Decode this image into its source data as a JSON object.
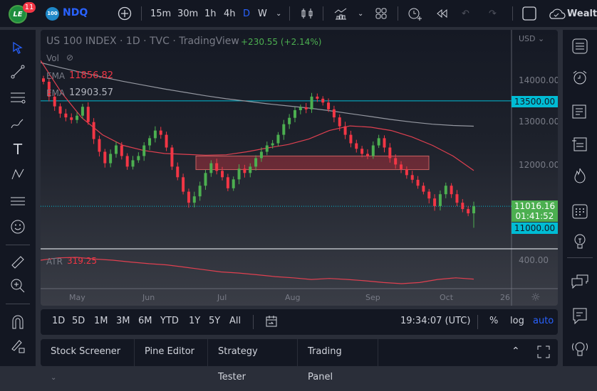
{
  "topbar": {
    "notifications": "11",
    "symbol_badge": "100",
    "symbol": "NDQ",
    "intervals": [
      "15m",
      "30m",
      "1h",
      "4h",
      "D",
      "W"
    ],
    "active_interval": "D",
    "publish_label": "Wealth"
  },
  "legend": {
    "title": "US 100 INDEX · 1D · TVC · TradingView",
    "change": "+230.55 (+2.14%)",
    "vol": "Vol",
    "ema1_label": "EMA",
    "ema1_value": "11856.82",
    "ema2_label": "EMA",
    "ema2_value": "12903.57",
    "atr_label": "ATR",
    "atr_value": "319.25"
  },
  "price_axis": {
    "currency": "USD",
    "ticks": [
      "14000.00",
      "13000.00",
      "12000.00"
    ],
    "hline_label": "13500.00",
    "last_price": "11016.16",
    "countdown": "01:41:52",
    "alert_label": "11000.00",
    "atr_tick": "400.00"
  },
  "time_axis": [
    "May",
    "Jun",
    "Jul",
    "Aug",
    "Sep",
    "Oct",
    "26"
  ],
  "timebar": {
    "ranges": [
      "1D",
      "5D",
      "1M",
      "3M",
      "6M",
      "YTD",
      "1Y",
      "5Y",
      "All"
    ],
    "clock": "19:34:07 (UTC)",
    "percent": "%",
    "log": "log",
    "auto": "auto"
  },
  "bottom_tabs": [
    "Stock Screener",
    "Pine Editor",
    "Strategy Tester",
    "Trading Panel"
  ],
  "colors": {
    "up": "#26a69a",
    "down": "#f23645",
    "green": "#4caf50",
    "cyan": "#00bcd4",
    "accent": "#2962ff",
    "ema_fast": "#e04050",
    "ema_slow": "#9598a1"
  },
  "chart_data": {
    "type": "candlestick",
    "closes": [
      13950,
      13600,
      13370,
      13200,
      13110,
      13050,
      13150,
      13360,
      13000,
      12600,
      12300,
      12030,
      12250,
      12450,
      12200,
      11950,
      12100,
      12200,
      12450,
      12620,
      12800,
      12700,
      12400,
      11950,
      11700,
      11360,
      11100,
      11250,
      11500,
      11800,
      12030,
      11850,
      11700,
      11440,
      11650,
      11900,
      11800,
      11950,
      12150,
      12300,
      12450,
      12500,
      12700,
      12950,
      13100,
      13280,
      13350,
      13300,
      13600,
      13550,
      13460,
      13300,
      13110,
      12900,
      12700,
      12500,
      12370,
      12250,
      12200,
      12450,
      12620,
      12400,
      12150,
      12000,
      11890,
      11750,
      11640,
      11500,
      11360,
      11200,
      11020,
      11300,
      11500,
      11300,
      11100,
      10950,
      10850,
      11016.16
    ],
    "ema_fast": [
      14450,
      13700,
      13100,
      12700,
      12450,
      12330,
      12260,
      12240,
      12220,
      12230,
      12300,
      12390,
      12470,
      12600,
      12800,
      12910,
      12880,
      12800,
      12650,
      12450,
      12200,
      11856.82
    ],
    "ema_slow": [
      14400,
      14280,
      14170,
      14060,
      13960,
      13870,
      13780,
      13700,
      13620,
      13550,
      13490,
      13430,
      13380,
      13330,
      13270,
      13200,
      13130,
      13060,
      13000,
      12950,
      12920,
      12903.57
    ],
    "hline": 13500,
    "zone": [
      11880,
      12200
    ],
    "atr": [
      400,
      410,
      412,
      405,
      400,
      392,
      385,
      380,
      370,
      360,
      350,
      345,
      338,
      330,
      325,
      318,
      322,
      318,
      312,
      305,
      300,
      305,
      318,
      325,
      319.25
    ],
    "ylim": [
      10400,
      14500
    ]
  }
}
